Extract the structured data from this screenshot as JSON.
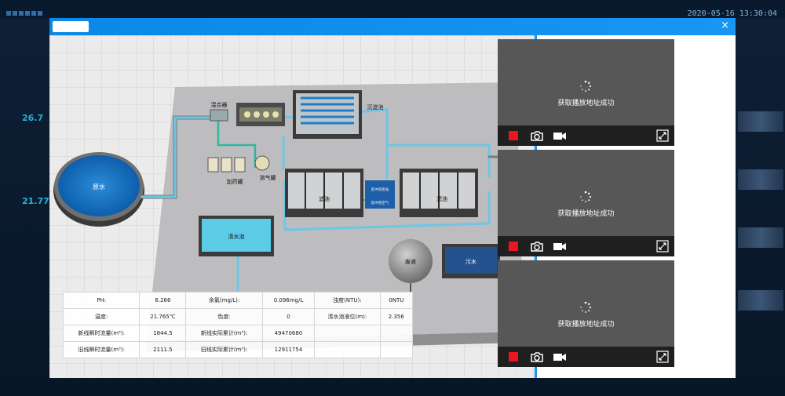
{
  "background": {
    "datetime": "2020-05-16 13:30:04",
    "left_values": [
      "26.7",
      "21.77"
    ]
  },
  "window": {
    "close_glyph": "×",
    "accent_color": "#1996f3"
  },
  "scene_labels": {
    "mixer": "混合器",
    "sedimentation": "沉淀池",
    "dosing": "加药罐",
    "aeration": "溶气罐",
    "filter_left": "滤池",
    "filter_right": "滤池",
    "pump_top": "反冲洗泵站",
    "pump_bottom": "反冲洗空气",
    "raw_water": "原水",
    "clear_water": "清水池",
    "sludge": "废液",
    "waste_water": "污水"
  },
  "metrics": [
    [
      {
        "label": "PH:",
        "value": "6.266"
      },
      {
        "label": "余氯(mg/L):",
        "value": "0.096mg/L"
      },
      {
        "label": "浊度(NTU):",
        "value": "0NTU"
      }
    ],
    [
      {
        "label": "温度:",
        "value": "21.765℃"
      },
      {
        "label": "色度:",
        "value": "0"
      },
      {
        "label": "清水池液位(m):",
        "value": "2.356"
      }
    ],
    [
      {
        "label": "新线瞬时流量(m³):",
        "value": "1844.5"
      },
      {
        "label": "新线实际累计(m³):",
        "value": "49470680"
      },
      {
        "label": "",
        "value": ""
      }
    ],
    [
      {
        "label": "旧线瞬时流量(m³):",
        "value": "2111.5"
      },
      {
        "label": "旧线实际累计(m³):",
        "value": "12911754"
      },
      {
        "label": "",
        "value": ""
      }
    ]
  ],
  "cameras": [
    {
      "status": "获取播放地址成功"
    },
    {
      "status": "获取播放地址成功"
    },
    {
      "status": "获取播放地址成功"
    }
  ],
  "icons": {
    "record": "record-icon",
    "snapshot": "camera-icon",
    "video": "video-icon",
    "fullscreen": "fullscreen-icon"
  }
}
